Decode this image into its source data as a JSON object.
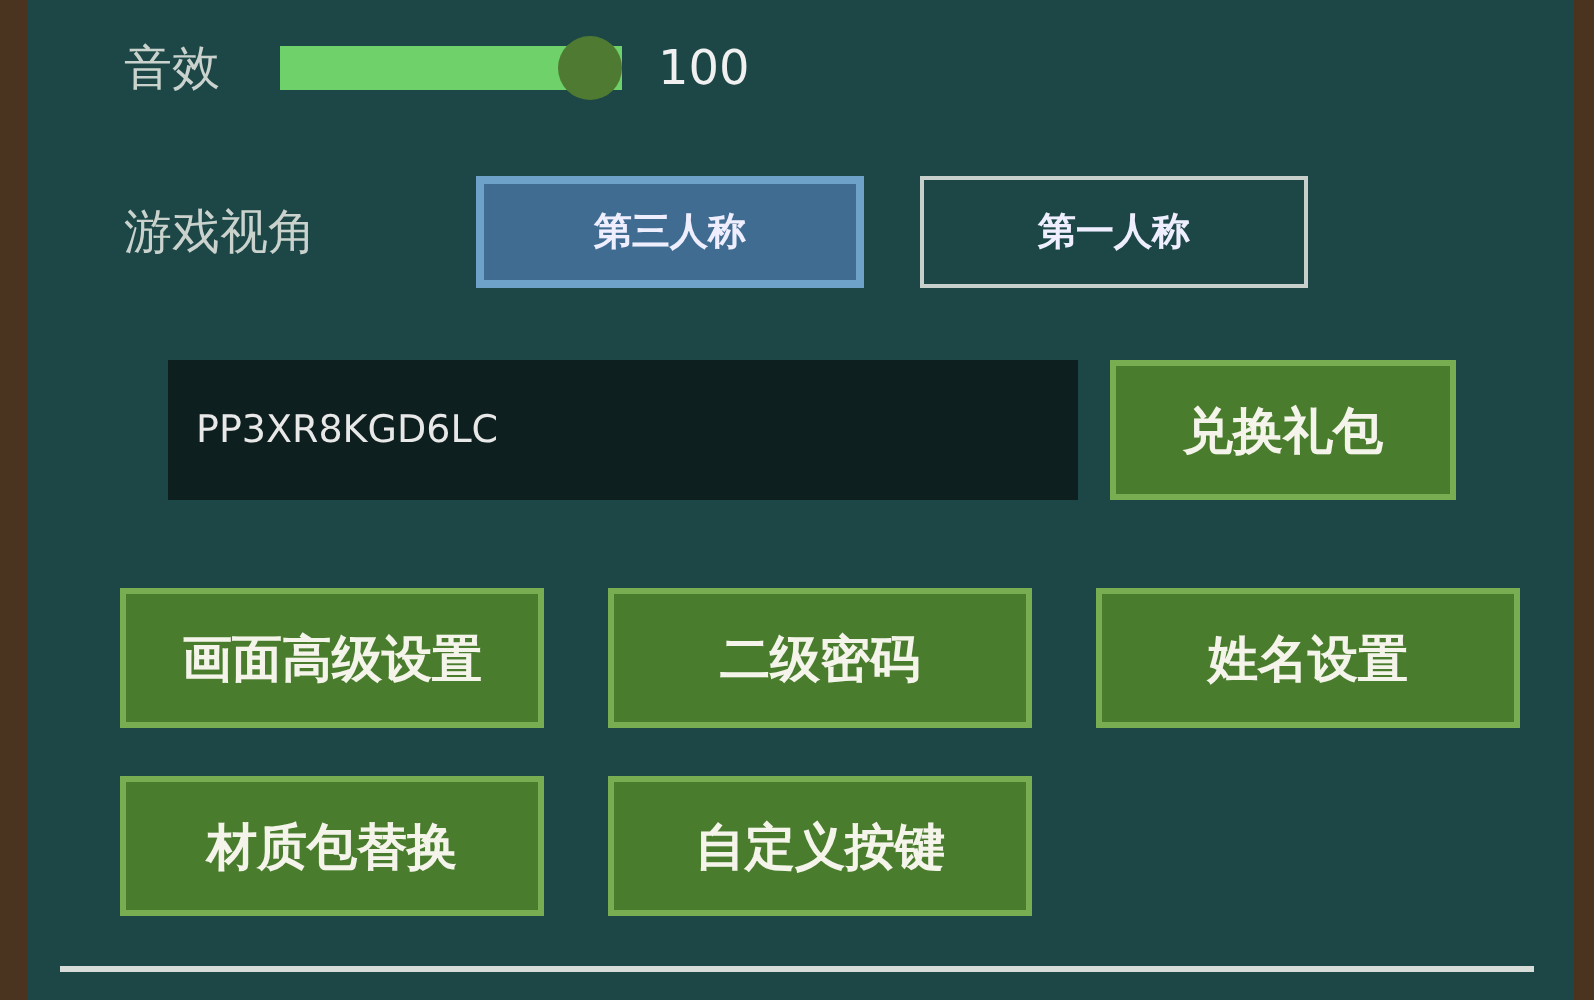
{
  "sound": {
    "label": "音效",
    "level": 1,
    "value": "100"
  },
  "view": {
    "label": "游戏视角",
    "options": [
      {
        "label": "第三人称",
        "selected": true
      },
      {
        "label": "第一人称",
        "selected": false
      }
    ]
  },
  "redeem": {
    "value": "PP3XR8KGD6LC",
    "button": "兑换礼包"
  },
  "buttons": [
    "画面高级设置",
    "二级密码",
    "姓名设置",
    "材质包替换",
    "自定义按键"
  ]
}
